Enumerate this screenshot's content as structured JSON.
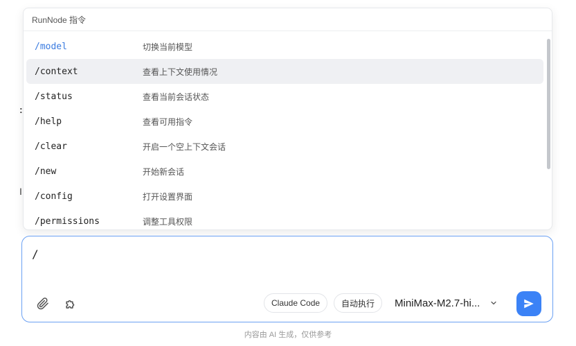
{
  "popup": {
    "header": "RunNode 指令",
    "commands": [
      {
        "name": "/model",
        "desc": "切换当前模型",
        "selected": true
      },
      {
        "name": "/context",
        "desc": "查看上下文使用情况",
        "active": true
      },
      {
        "name": "/status",
        "desc": "查看当前会话状态"
      },
      {
        "name": "/help",
        "desc": "查看可用指令"
      },
      {
        "name": "/clear",
        "desc": "开启一个空上下文会话"
      },
      {
        "name": "/new",
        "desc": "开始新会话"
      },
      {
        "name": "/config",
        "desc": "打开设置界面"
      },
      {
        "name": "/permissions",
        "desc": "调整工具权限"
      }
    ]
  },
  "composer": {
    "value": "/",
    "mode_pill": "Claude Code",
    "auto_pill": "自动执行",
    "model": "MiniMax-M2.7-hi...",
    "icons": {
      "attach": "paperclip-icon",
      "plugin": "puzzle-icon",
      "dropdown": "chevron-down-icon",
      "send": "send-icon"
    }
  },
  "footer": "内容由 AI 生成，仅供参考",
  "colors": {
    "accent": "#3b82f6",
    "selected_text": "#3a7be0",
    "active_row": "#eff0f3",
    "composer_border": "#6aa0f3"
  }
}
